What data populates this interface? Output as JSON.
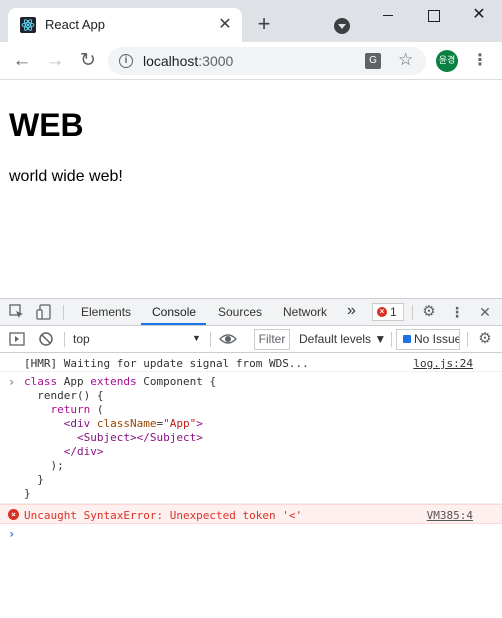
{
  "browser": {
    "tab": {
      "title": "React App",
      "close_glyph": "✕",
      "favicon": "react-icon"
    },
    "new_tab_glyph": "+",
    "window_close_glyph": "✕",
    "nav": {
      "back_glyph": "←",
      "forward_glyph": "→",
      "reload_glyph": "↻"
    },
    "omnibox": {
      "host": "localhost",
      "port": ":3000",
      "info_glyph": "i"
    },
    "translate_glyph": "G",
    "star_glyph": "☆",
    "profile_initials": "윤경",
    "menu_glyph": "⋮",
    "colors": {
      "tabstrip": "#dee1e6",
      "profile": "#0b8043",
      "react": "#61dafb"
    }
  },
  "page": {
    "heading": "WEB",
    "paragraph": "world wide web!"
  },
  "devtools": {
    "tabs": [
      {
        "label": "Elements",
        "active": false
      },
      {
        "label": "Console",
        "active": true
      },
      {
        "label": "Sources",
        "active": false
      },
      {
        "label": "Network",
        "active": false
      }
    ],
    "more_tabs_glyph": "»",
    "error_count": "1",
    "settings_glyph": "⚙",
    "menu_glyph": "⋮",
    "close_glyph": "✕",
    "context": "top",
    "filter_placeholder": "Filter",
    "levels_label": "Default levels ▼",
    "issues_label": "No Issues",
    "console": {
      "hmr_message": "[HMR] Waiting for update signal from WDS...",
      "hmr_source": "log.js:24",
      "code": {
        "l1_kw1": "class",
        "l1_name": " App ",
        "l1_kw2": "extends",
        "l1_rest": " Component {",
        "l2": "  render() {",
        "l3_kw": "return",
        "l3_rest": " (",
        "l4_open": "<div ",
        "l4_attr": "className",
        "l4_eq": "=",
        "l4_val": "\"App\"",
        "l4_close": ">",
        "l5": "<Subject></Subject>",
        "l6": "</div>",
        "l7": "    );",
        "l8": "  }",
        "l9": "}"
      },
      "error_message": "Uncaught SyntaxError: Unexpected token '<'",
      "error_source": "VM385:4",
      "prompt_glyph": "›"
    }
  }
}
